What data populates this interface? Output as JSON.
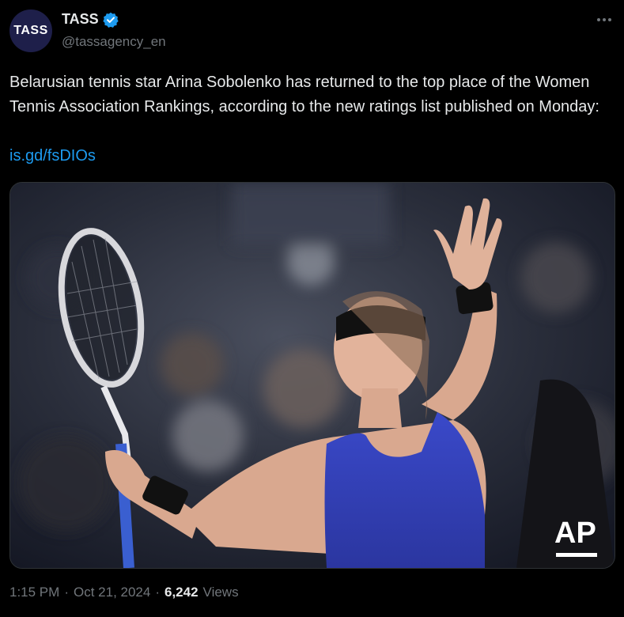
{
  "author": {
    "avatar_text": "TASS",
    "display_name": "TASS",
    "handle": "@tassagency_en",
    "verified": true
  },
  "tweet": {
    "text": "Belarusian tennis star Arina Sobolenko has returned to the top place of the Women Tennis Association Rankings, according to the new ratings list published on Monday:",
    "link": "is.gd/fsDIOs",
    "media": {
      "watermark": "AP",
      "description_icon": "photo-of-tennis-player-waving"
    }
  },
  "meta": {
    "time": "1:15 PM",
    "separator": "·",
    "date": "Oct 21, 2024",
    "views_count": "6,242",
    "views_label": "Views"
  },
  "colors": {
    "background": "#000000",
    "text": "#e7e9ea",
    "secondary": "#71767b",
    "link": "#1d9bf0",
    "verified": "#1d9bf0"
  }
}
